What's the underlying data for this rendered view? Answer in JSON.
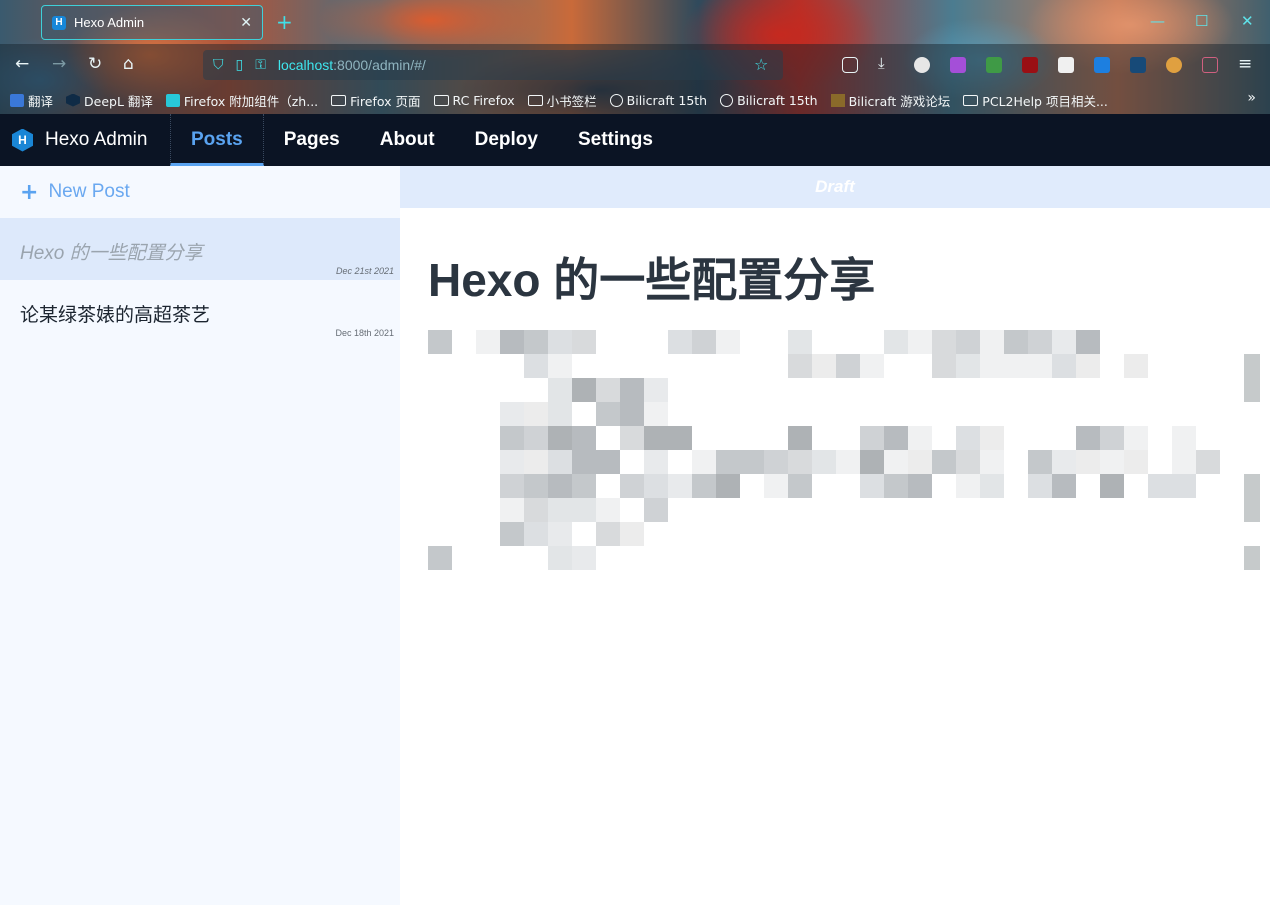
{
  "browser": {
    "tab_title": "Hexo Admin",
    "tab_favicon": "H",
    "url_host": "localhost",
    "url_rest": ":8000/admin/#/",
    "bookmarks": [
      {
        "label": "翻译",
        "icon": "translate-icon"
      },
      {
        "label": "DeepL 翻译",
        "icon": "deepl-icon"
      },
      {
        "label": "Firefox 附加组件（zh...",
        "icon": "puzzle-icon"
      },
      {
        "label": "Firefox 页面",
        "icon": "folder-icon"
      },
      {
        "label": "RC Firefox",
        "icon": "folder-icon"
      },
      {
        "label": "小书签栏",
        "icon": "folder-icon"
      },
      {
        "label": "Bilicraft 15th",
        "icon": "globe-icon"
      },
      {
        "label": "Bilicraft 15th",
        "icon": "globe-icon"
      },
      {
        "label": "Bilicraft 游戏论坛",
        "icon": "block-icon"
      },
      {
        "label": "PCL2Help 项目相关...",
        "icon": "folder-icon"
      }
    ]
  },
  "app": {
    "brand_logo": "H",
    "brand_name": "Hexo Admin",
    "nav": [
      "Posts",
      "Pages",
      "About",
      "Deploy",
      "Settings"
    ],
    "active_nav": "Posts"
  },
  "sidebar": {
    "new_post_label": "New Post",
    "posts": [
      {
        "title": "Hexo 的一些配置分享",
        "date": "Dec 21st 2021",
        "active": true
      },
      {
        "title": "论某绿茶婊的高超茶艺",
        "date": "Dec 18th 2021",
        "active": false
      }
    ]
  },
  "main": {
    "status": "Draft",
    "title": "Hexo 的一些配置分享"
  },
  "colors": {
    "appbar": "#0b1424",
    "accent": "#5aa3f0",
    "sidebar_bg": "#f5f9ff",
    "active_row": "#dde9fb",
    "draft_bar": "#e0ebfc"
  }
}
